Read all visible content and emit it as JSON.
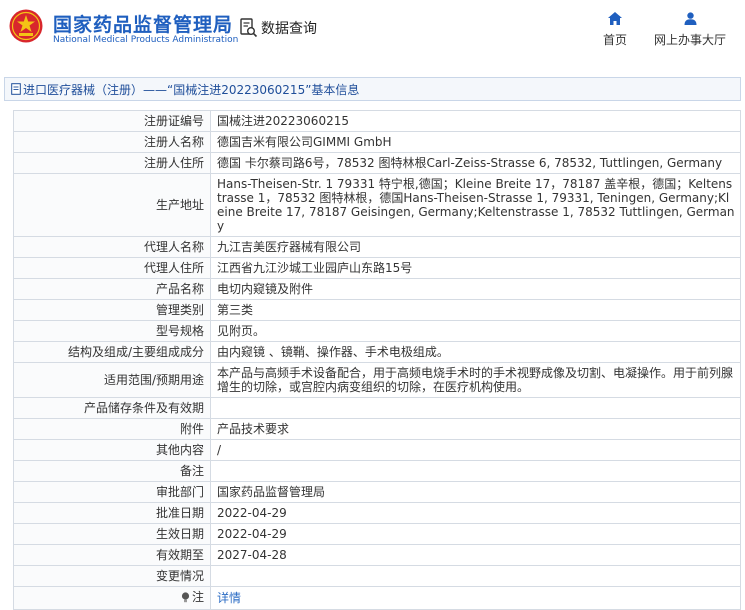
{
  "header": {
    "org_name_cn": "国家药品监督管理局",
    "org_name_en": "National Medical Products Administration",
    "logo_icon": "nmpa-emblem-icon",
    "query_label": "数据查询",
    "query_icon": "document-search-icon",
    "nav": [
      {
        "label": "首页",
        "icon": "home-icon"
      },
      {
        "label": "网上办事大厅",
        "icon": "user-icon"
      }
    ]
  },
  "breadcrumb": {
    "icon": "document-icon",
    "text": "进口医疗器械（注册）——“国械注进20223060215”基本信息"
  },
  "rows": [
    {
      "key": "注册证编号",
      "value": "国械注进20223060215"
    },
    {
      "key": "注册人名称",
      "value": "德国吉米有限公司GIMMI GmbH"
    },
    {
      "key": "注册人住所",
      "value": "德国 卡尔蔡司路6号，78532 图特林根Carl-Zeiss-Strasse 6, 78532, Tuttlingen, Germany"
    },
    {
      "key": "生产地址",
      "value": "Hans-Theisen-Str. 1 79331 特宁根,德国；Kleine Breite 17，78187 盖辛根，德国；Keltenstrasse 1，78532 图特林根，德国Hans-Theisen-Strasse 1, 79331, Teningen, Germany;Kleine Breite 17, 78187 Geisingen, Germany;Keltenstrasse 1, 78532 Tuttlingen, Germany"
    },
    {
      "key": "代理人名称",
      "value": "九江吉美医疗器械有限公司"
    },
    {
      "key": "代理人住所",
      "value": "江西省九江沙城工业园庐山东路15号"
    },
    {
      "key": "产品名称",
      "value": "电切内窥镜及附件"
    },
    {
      "key": "管理类别",
      "value": "第三类"
    },
    {
      "key": "型号规格",
      "value": "见附页。"
    },
    {
      "key": "结构及组成/主要组成成分",
      "value": "由内窥镜 、镜鞘、操作器、手术电极组成。"
    },
    {
      "key": "适用范围/预期用途",
      "value": "本产品与高频手术设备配合，用于高频电烧手术时的手术视野成像及切割、电凝操作。用于前列腺增生的切除，或宫腔内病变组织的切除，在医疗机构使用。"
    },
    {
      "key": "产品储存条件及有效期",
      "value": ""
    },
    {
      "key": "附件",
      "value": "产品技术要求"
    },
    {
      "key": "其他内容",
      "value": "/"
    },
    {
      "key": "备注",
      "value": ""
    },
    {
      "key": "审批部门",
      "value": "国家药品监督管理局"
    },
    {
      "key": "批准日期",
      "value": "2022-04-29"
    },
    {
      "key": "生效日期",
      "value": "2022-04-29"
    },
    {
      "key": "有效期至",
      "value": "2027-04-28"
    },
    {
      "key": "变更情况",
      "value": ""
    }
  ],
  "note": {
    "key": "注",
    "icon": "info-bulb-icon",
    "link_label": "详情"
  },
  "colors": {
    "brand_blue": "#1f5fbf",
    "link_blue": "#2b6cc4",
    "logo_red": "#d8262c",
    "logo_gold": "#f4c316"
  }
}
